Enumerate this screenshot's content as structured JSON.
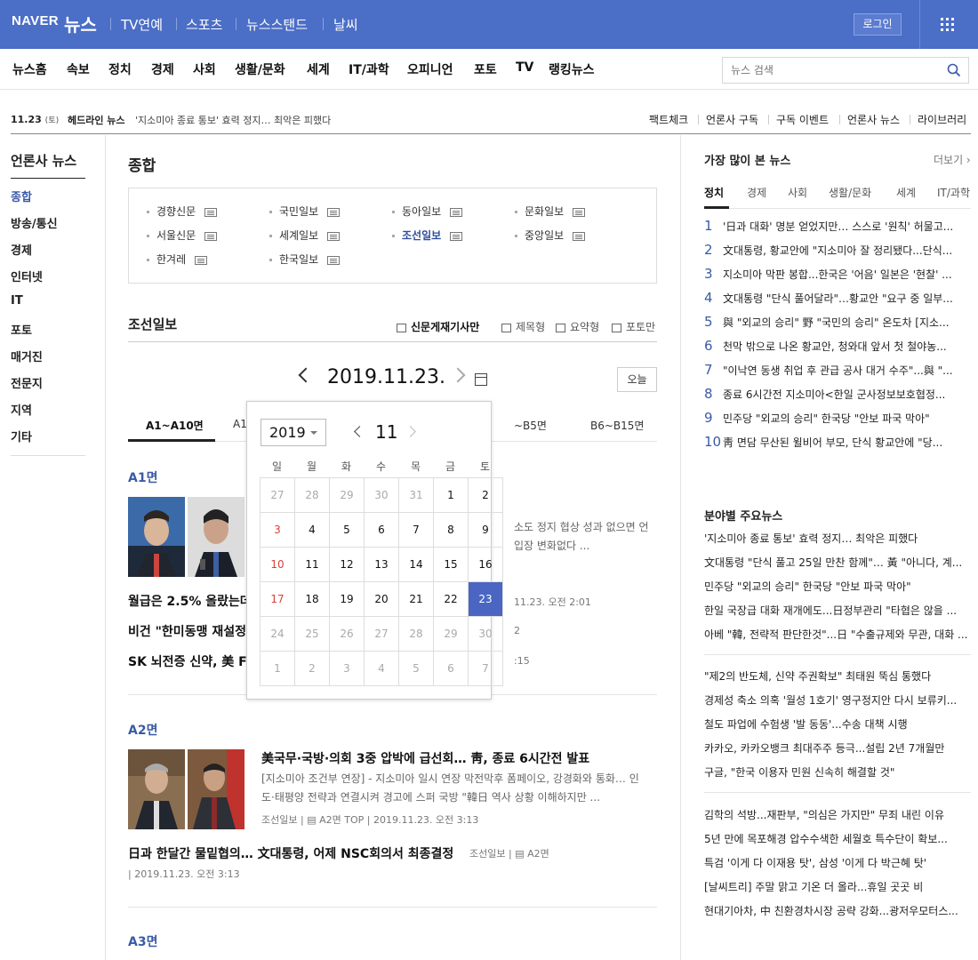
{
  "topbar": {
    "logo": "NAVER",
    "service": "뉴스",
    "tabs": [
      "TV연예",
      "스포츠",
      "뉴스스탠드",
      "날씨"
    ],
    "login": "로그인"
  },
  "menu": {
    "items": [
      "뉴스홈",
      "속보",
      "정치",
      "경제",
      "사회",
      "생활/문화",
      "세계",
      "IT/과학",
      "오피니언",
      "포토",
      "TV",
      "랭킹뉴스"
    ],
    "search_placeholder": "뉴스 검색"
  },
  "headline": {
    "date": "11.23",
    "weekday": "(토)",
    "label": "헤드라인 뉴스",
    "text": "'지소미아 종료 통보' 효력 정지… 최악은 피했다",
    "links": [
      "팩트체크",
      "언론사 구독",
      "구독 이벤트",
      "언론사 뉴스",
      "라이브러리"
    ]
  },
  "left": {
    "title": "언론사 뉴스",
    "items": [
      "종합",
      "방송/통신",
      "경제",
      "인터넷",
      "IT",
      "포토",
      "매거진",
      "전문지",
      "지역",
      "기타"
    ]
  },
  "main": {
    "section_title": "종합",
    "press": [
      "경향신문",
      "국민일보",
      "동아일보",
      "문화일보",
      "서울신문",
      "세계일보",
      "조선일보",
      "중앙일보",
      "한겨레",
      "한국일보"
    ],
    "selected_press": "조선일보",
    "paper_title": "조선일보",
    "view_modes": [
      "신문게재기사만",
      "제목형",
      "요약형",
      "포토만"
    ],
    "date": "2019.11.23.",
    "today": "오늘",
    "page_tabs": [
      "A1~A10면",
      "A1",
      "~B5면",
      "B6~B15면"
    ],
    "pages": [
      {
        "label": "A1면",
        "lead_summary": [
          "소도 정지 협상 성과 없으면 언",
          "입장 변화없다 ..."
        ],
        "items": [
          {
            "title": "월급은 2.5% 올랐는데",
            "meta": "11.23. 오전 2:01"
          },
          {
            "title": "비건 \"한미동맹 재설정",
            "meta": "2"
          },
          {
            "title": "SK 뇌전증 신약, 美 FD",
            "meta": ":15"
          }
        ]
      },
      {
        "label": "A2면",
        "lead": {
          "title": "美국무·국방·의회 3중 압박에 급선회… 靑, 종료 6시간전 발표",
          "summary": [
            "[지소미아 조건부 연장] - 지소미아 일시 연장 막전막후 폼페이오, 강경화와 통화… 인",
            "도·태평양 전략과 연결시켜 경고에 스퍼 국방 \"韓日 역사 상황 이해하지만 ..."
          ],
          "source": "조선일보",
          "page": "A2면 TOP",
          "time": "2019.11.23. 오전 3:13"
        },
        "second": {
          "title": "日과 한달간 물밑협의… 文대통령, 어제 NSC회의서 최종결정",
          "source": "조선일보",
          "page": "A2면",
          "time": "2019.11.23. 오전 3:13"
        }
      },
      {
        "label": "A3면"
      }
    ]
  },
  "calendar": {
    "year": "2019",
    "month": "11",
    "weekdays": [
      "일",
      "월",
      "화",
      "수",
      "목",
      "금",
      "토"
    ],
    "days": [
      [
        "27",
        "28",
        "29",
        "30",
        "31",
        "1",
        "2"
      ],
      [
        "3",
        "4",
        "5",
        "6",
        "7",
        "8",
        "9"
      ],
      [
        "10",
        "11",
        "12",
        "13",
        "14",
        "15",
        "16"
      ],
      [
        "17",
        "18",
        "19",
        "20",
        "21",
        "22",
        "23"
      ],
      [
        "24",
        "25",
        "26",
        "27",
        "28",
        "29",
        "30"
      ],
      [
        "1",
        "2",
        "3",
        "4",
        "5",
        "6",
        "7"
      ]
    ],
    "selected_day": "23"
  },
  "right": {
    "title": "가장 많이 본 뉴스",
    "more": "더보기 ›",
    "tabs": [
      "정치",
      "경제",
      "사회",
      "생활/문화",
      "세계",
      "IT/과학"
    ],
    "ranking": [
      "'日과 대화' 명분 얻었지만… 스스로 '원칙' 허물고...",
      "文대통령, 황교안에 \"지소미아 잘 정리됐다...단식...",
      "지소미아 막판 봉합...한국은 '어음' 일본은 '현찰' ...",
      "文대통령 \"단식 풀어달라\"…황교안 \"요구 중 일부...",
      "與 \"외교의 승리\" 野 \"국민의 승리\" 온도차 [지소...",
      "천막 밖으로 나온 황교안, 청와대 앞서 첫 철야농...",
      "\"이낙연 동생 취업 후 관급 공사 대거 수주\"...與 \"...",
      "종료 6시간전 지소미아<한일 군사정보보호협정...",
      "민주당 \"외교의 승리\" 한국당 \"안보 파국 막아\"",
      "靑 면담 무산된 윌비어 부모, 단식 황교안에 \"당..."
    ],
    "section_title": "분야별 주요뉴스",
    "group1": [
      "'지소미아 종료 통보' 효력 정지… 최악은 피했다",
      "文대통령 \"단식 풀고 25일 만찬 함께\"… 黃 \"아니다, 계...",
      "민주당 \"외교의 승리\" 한국당 \"안보 파국 막아\"",
      "한일 국장급 대화 재개에도...日정부관리 \"타협은 않을 ...",
      "아베 \"韓, 전략적 판단한것\"...日 \"수출규제와 무관, 대화 ..."
    ],
    "group2": [
      "\"제2의 반도체, 신약 주권확보\" 최태원 뚝심 통했다",
      "경제성 축소 의혹 '월성 1호기' 영구정지안 다시 보류키...",
      "철도 파업에 수험생 '발 동동'...수송 대책 시행",
      "카카오, 카카오뱅크 최대주주 등극...설립 2년 7개월만",
      "구글, \"한국 이용자 민원 신속히 해결할 것\""
    ],
    "group3": [
      "김학의 석방...재판부, \"의심은 가지만\" 무죄 내린 이유",
      "5년 만에 목포해경 압수수색한 세월호 특수단이 확보...",
      "특검 '이게 다 이재용 탓', 삼성 '이게 다 박근혜 탓'",
      "[날씨트리] 주말 맑고 기온 더 올라...휴일 곳곳 비",
      "현대기아차, 中 친환경차시장 공략 강화...광저우모터스..."
    ]
  },
  "colors": {
    "brand_blue": "#4b6ec6",
    "accent_blue": "#3a5aa8",
    "selected_day": "#4a66c2",
    "sunday": "#d9403a"
  }
}
